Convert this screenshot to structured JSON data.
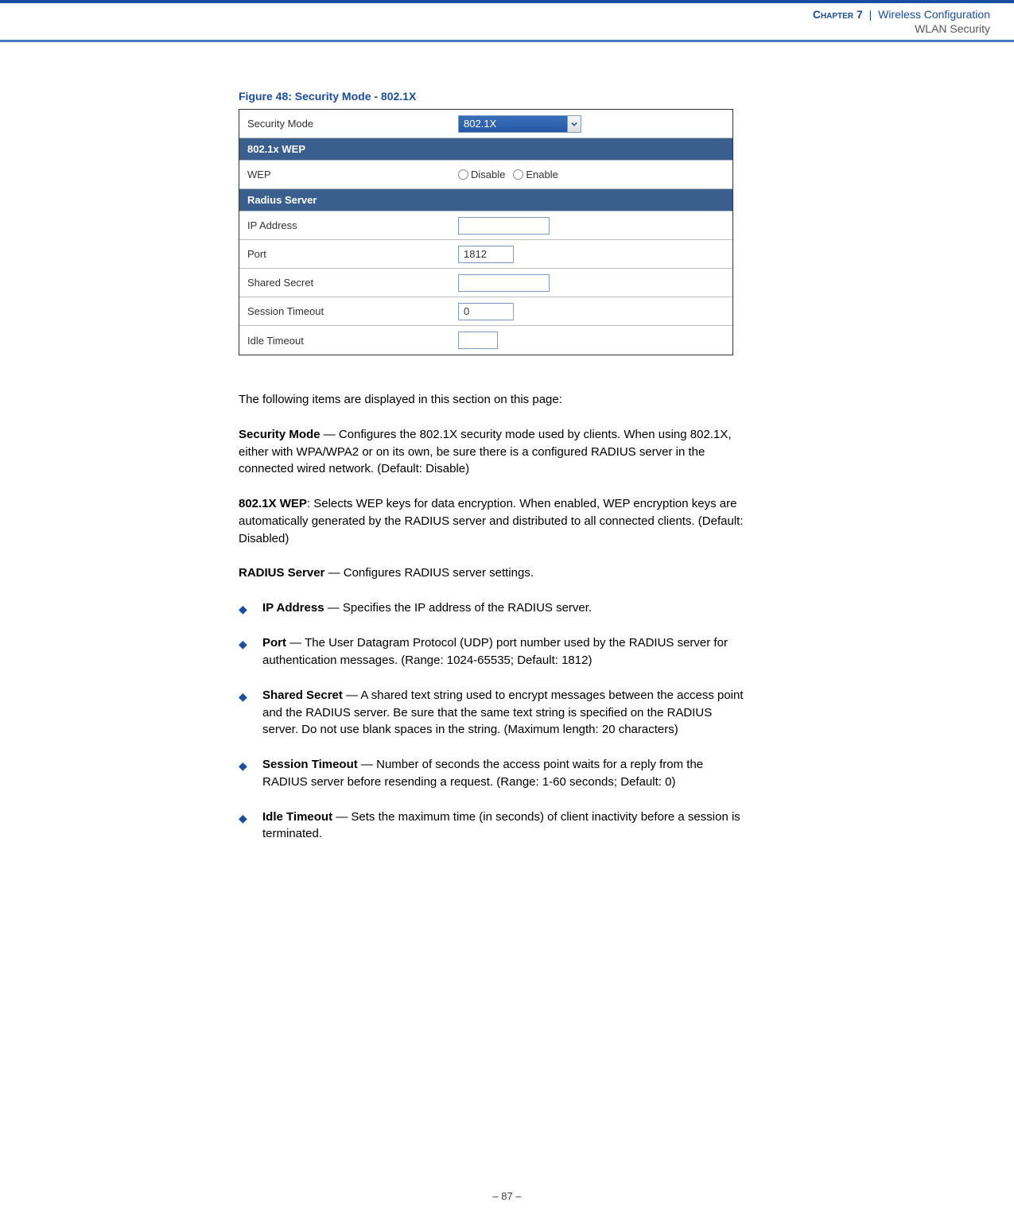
{
  "header": {
    "chapter_label": "Chapter 7",
    "separator": "|",
    "chapter_title": "Wireless Configuration",
    "subtitle": "WLAN Security"
  },
  "figure": {
    "caption": "Figure 48:  Security Mode - 802.1X"
  },
  "screenshot": {
    "security_mode_label": "Security Mode",
    "security_mode_value": "802.1X",
    "section_wep": "802.1x WEP",
    "wep_label": "WEP",
    "wep_disable_label": "Disable",
    "wep_enable_label": "Enable",
    "section_radius": "Radius Server",
    "ip_label": "IP Address",
    "ip_value": "",
    "port_label": "Port",
    "port_value": "1812",
    "secret_label": "Shared Secret",
    "secret_value": "",
    "session_timeout_label": "Session Timeout",
    "session_timeout_value": "0",
    "idle_timeout_label": "Idle Timeout",
    "idle_timeout_value": ""
  },
  "body": {
    "intro": "The following items are displayed in this section on this page:",
    "security_mode": {
      "term": "Security Mode",
      "sep": " — ",
      "desc": "Configures the 802.1X security mode used by clients. When using 802.1X, either with WPA/WPA2 or on its own, be sure there is a configured RADIUS server in the connected wired network. (Default: Disable)"
    },
    "wep": {
      "term": "802.1X WEP",
      "sep": ": ",
      "desc": "Selects WEP keys for data encryption. When enabled, WEP encryption keys are automatically generated by the RADIUS server and distributed to all connected clients. (Default: Disabled)"
    },
    "radius": {
      "term": "RADIUS Server",
      "sep": " — ",
      "desc": "Configures RADIUS server settings."
    },
    "bullets": [
      {
        "term": "IP Address",
        "sep": " — ",
        "desc": "Specifies the IP address of the RADIUS server."
      },
      {
        "term": "Port",
        "sep": " — ",
        "desc": "The User Datagram Protocol (UDP) port number used by the RADIUS server for authentication messages. (Range: 1024-65535; Default: 1812)"
      },
      {
        "term": "Shared Secret",
        "sep": " — ",
        "desc": "A shared text string used to encrypt messages between the access point and the RADIUS server. Be sure that the same text string is specified on the RADIUS server. Do not use blank spaces in the string. (Maximum length: 20 characters)"
      },
      {
        "term": "Session Timeout",
        "sep": " — ",
        "desc": "Number of seconds the access point waits for a reply from the RADIUS server before resending a request. (Range: 1-60 seconds; Default: 0)"
      },
      {
        "term": "Idle Timeout",
        "sep": " — ",
        "desc": "Sets the maximum time (in seconds) of client inactivity before a session is terminated."
      }
    ]
  },
  "footer": {
    "page": "–  87  –"
  }
}
